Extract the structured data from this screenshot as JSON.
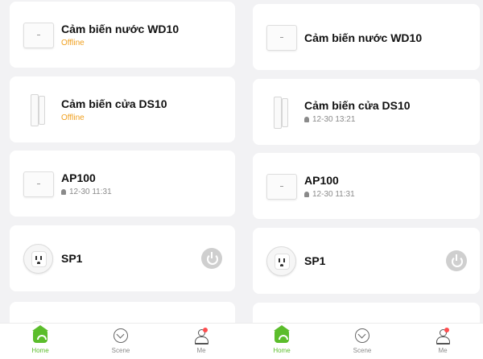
{
  "left": {
    "devices": [
      {
        "name": "Cảm biến nước WD10",
        "status": "Offline",
        "icon": "water-sensor-icon"
      },
      {
        "name": "Cảm biến cửa DS10",
        "status": "Offline",
        "icon": "door-sensor-icon"
      },
      {
        "name": "AP100",
        "last_event": "12-30 11:31",
        "icon": "hub-icon"
      },
      {
        "name": "SP1",
        "icon": "smart-plug-icon",
        "power_button": true
      }
    ]
  },
  "right": {
    "devices": [
      {
        "name": "Cảm biến nước WD10",
        "icon": "water-sensor-icon"
      },
      {
        "name": "Cảm biến cửa DS10",
        "last_event": "12-30 13:21",
        "icon": "door-sensor-icon"
      },
      {
        "name": "AP100",
        "last_event": "12-30 11:31",
        "icon": "hub-icon"
      },
      {
        "name": "SP1",
        "icon": "smart-plug-icon",
        "power_button": true
      }
    ]
  },
  "tabbar": {
    "home": "Home",
    "scene": "Scene",
    "me": "Me"
  },
  "colors": {
    "accent": "#5bbd2b",
    "offline": "#f0a020",
    "background": "#f2f2f4",
    "notification": "#ff4d4f"
  }
}
